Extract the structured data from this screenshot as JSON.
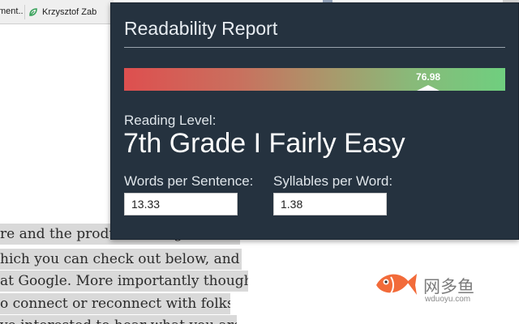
{
  "browser": {
    "tab_fragment_1": "ment..",
    "tab_fragment_2": "Krzysztof Zab"
  },
  "article": {
    "lines": [
      "re and the product management",
      "hich you can check out below, and",
      "at Google. More importantly though,",
      "o connect or reconnect with folks.",
      "ve interested to hear what you are"
    ]
  },
  "popup": {
    "title": "Readability Report",
    "score_label": "76.98",
    "score_fraction": 0.798,
    "reading_level_label": "Reading Level:",
    "reading_level_value": "7th Grade I Fairly Easy",
    "words_per_sentence_label": "Words per Sentence:",
    "words_per_sentence_value": "13.33",
    "syllables_per_word_label": "Syllables per Word:",
    "syllables_per_word_value": "1.38",
    "colors": {
      "background": "#25323f",
      "bar_low": "#de4f4f",
      "bar_high": "#6fcf7f"
    }
  },
  "watermark": {
    "cn_text": "网多鱼",
    "en_text": "wduoyu.com",
    "icon": "fish-logo-icon",
    "color": "#f26b3a"
  }
}
